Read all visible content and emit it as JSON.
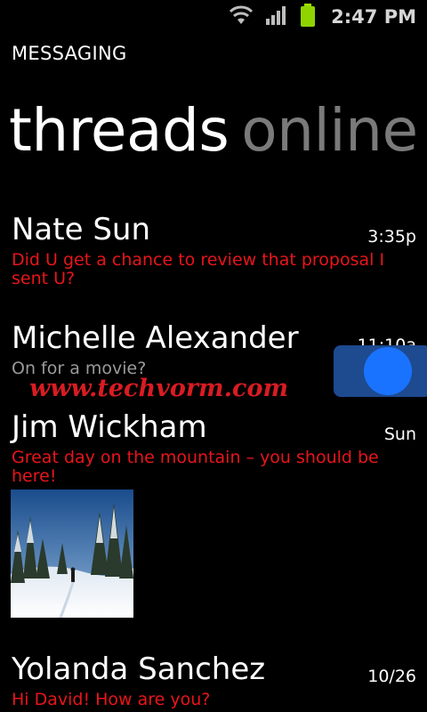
{
  "status_bar": {
    "time": "2:47 PM",
    "icons": [
      "wifi-icon",
      "signal-icon",
      "battery-icon"
    ]
  },
  "app": {
    "title": "MESSAGING"
  },
  "pivot": {
    "active": "threads",
    "inactive": "online"
  },
  "threads": [
    {
      "name": "Nate Sun",
      "time": "3:35p",
      "preview": "Did U get a chance to review that proposal I sent U?"
    },
    {
      "name": "Michelle Alexander",
      "time": "11:10a",
      "preview": "On for a movie?"
    },
    {
      "name": "Jim Wickham",
      "time": "Sun",
      "preview": "Great day on the mountain – you should be here!"
    },
    {
      "name": "Yolanda Sanchez",
      "time": "10/26",
      "preview": "Hi David! How are you?"
    }
  ],
  "watermark": "www.techvorm.com",
  "colors": {
    "background": "#000000",
    "unread_preview": "#e8151a",
    "read_preview": "#9a9a9a",
    "inactive_pivot": "#7a7a7a",
    "accent": "#1a73ff"
  }
}
